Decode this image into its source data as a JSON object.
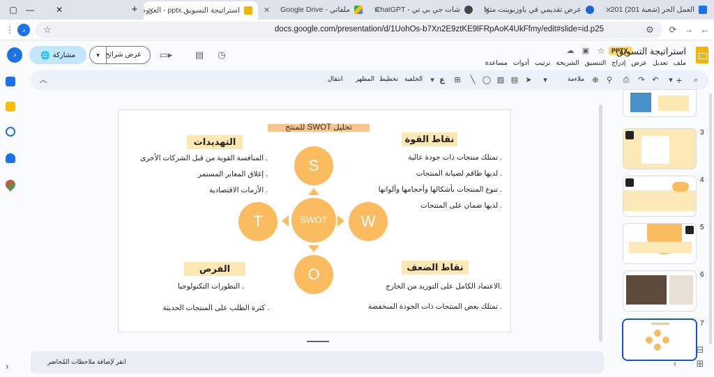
{
  "browser": {
    "tabs": [
      {
        "label": "العمل الحر (شعبة 201) 201",
        "favicon_color": "#1a73e8"
      },
      {
        "label": "عرض تقديمي في باوربوينت متوا",
        "favicon_color": "#1967d2"
      },
      {
        "label": "شات جي بي تي - ChatGPT",
        "favicon_color": "#444746"
      },
      {
        "label": "ملفاتي - Google Drive",
        "favicon_color": "#34a853"
      },
      {
        "label": "استراتيجة التسويق.pptx - العروض",
        "favicon_color": "#f4b400"
      }
    ],
    "new_tab_label": "+",
    "url": "docs.google.com/presentation/d/1UohOs-b7Xn2E9ztKE9lFRpAoK4UkFfmy/edit#slide=id.p25"
  },
  "doc": {
    "title": "استراتيجة التسويق",
    "badge": "PPTX.",
    "menus": [
      "ملف",
      "تعديل",
      "عرض",
      "إدراج",
      "التنسيق",
      "الشريحة",
      "ترتيب",
      "أدوات",
      "مساعدة"
    ],
    "share_label": "مشاركة",
    "present_label": "عرض شرائح"
  },
  "format_toolbar": {
    "zoom_label": "ملاءمة",
    "background_label": "الخلفية",
    "layout_label": "تخطيط",
    "theme_label": "المظهر",
    "transition_label": "انتقال"
  },
  "slide": {
    "title": "تحليل SWOT للمنتج",
    "headings": {
      "strengths": "نقاط القوة",
      "threats": "التهديدات",
      "weaknesses": "نقاط الضعف",
      "opportunities": "الفرص"
    },
    "strengths_items": [
      ". تمتلك منتجات ذات جودة عالية",
      ". لديها طاقم لصيانة المنتجات",
      ". تنوع المنتجات بأشكالها وأحجامها وألوانها",
      ". لديها ضمان على المنتجات"
    ],
    "threats_items": [
      ". المنافسة القوية من قبل الشركات الأخرى",
      ". إغلاق المعابر المستمر",
      ". الأزمات الاقتصادية"
    ],
    "weaknesses_items": [
      ".الاعتماد الكامل على التوريد من الخارج",
      ". تمتلك بعض المنتجات ذات الجودة المنخفضة"
    ],
    "opportunities_items": [
      ". التطورات التكنولوجيا",
      ". كثرة الطلب على المنتجات الحديثة"
    ],
    "circles": {
      "s": "S",
      "w": "W",
      "o": "O",
      "t": "T",
      "center": "SWOT"
    },
    "accent_color": "#fbbb5f"
  },
  "notes_placeholder": "انقر لإضافة ملاحظات المُحاضر",
  "filmstrip": {
    "slide_numbers": [
      "3",
      "4",
      "5",
      "6",
      "7"
    ]
  }
}
